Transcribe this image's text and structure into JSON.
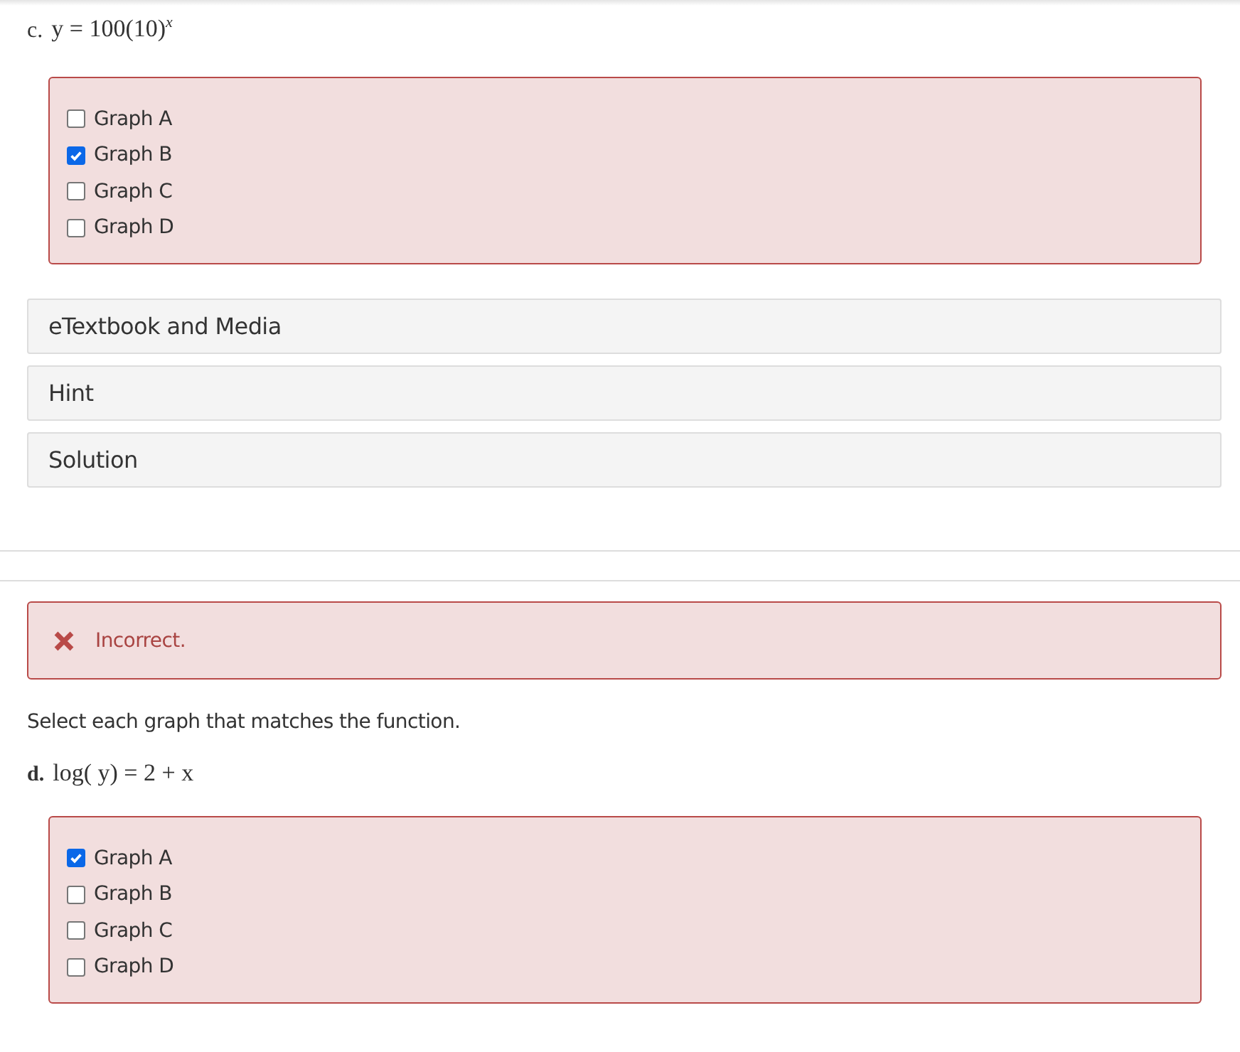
{
  "part_c": {
    "label": "c.",
    "equation": "y = 100(10)$^{x}$",
    "options": [
      {
        "label": "Graph A",
        "checked": false
      },
      {
        "label": "Graph B",
        "checked": true
      },
      {
        "label": "Graph C",
        "checked": false
      },
      {
        "label": "Graph D",
        "checked": false
      }
    ]
  },
  "resources": [
    "eTextbook and Media",
    "Hint",
    "Solution"
  ],
  "part_d": {
    "feedback": {
      "kind": "incorrect",
      "text": "Incorrect."
    },
    "instruction": "Select each graph that matches the function.",
    "label": "d.",
    "equation": "log( y) = 2 + x",
    "options": [
      {
        "label": "Graph A",
        "checked": true
      },
      {
        "label": "Graph B",
        "checked": false
      },
      {
        "label": "Graph C",
        "checked": false
      },
      {
        "label": "Graph D",
        "checked": false
      }
    ]
  }
}
